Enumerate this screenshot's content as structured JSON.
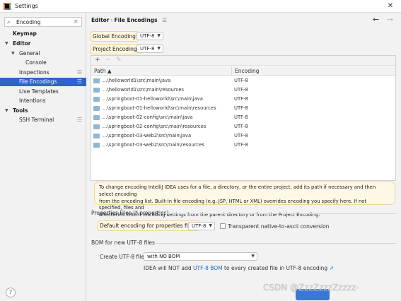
{
  "window": {
    "title": "Settings"
  },
  "sidebar": {
    "search_value": "Encoding",
    "items": [
      {
        "label": "Keymap"
      },
      {
        "label": "Editor"
      },
      {
        "label": "General"
      },
      {
        "label": "Console"
      },
      {
        "label": "Inspections"
      },
      {
        "label": "File Encodings"
      },
      {
        "label": "Live Templates"
      },
      {
        "label": "Intentions"
      },
      {
        "label": "Tools"
      },
      {
        "label": "SSH Terminal"
      }
    ]
  },
  "breadcrumb": {
    "parent": "Editor",
    "separator": "›",
    "current": "File Encodings"
  },
  "global": {
    "label": "Global Encoding:",
    "value": "UTF-8"
  },
  "project": {
    "label": "Project Encoding:",
    "value": "UTF-8"
  },
  "table": {
    "toolbar": {
      "add": "+",
      "remove": "−",
      "edit": "✎"
    },
    "columns": {
      "path": "Path ▲",
      "encoding": "Encoding"
    },
    "rows": [
      {
        "path": "...\\helloworld1\\src\\main\\java",
        "encoding": "UTF-8"
      },
      {
        "path": "...\\helloworld1\\src\\main\\resources",
        "encoding": "UTF-8"
      },
      {
        "path": "...\\springboot-01-helloworld\\src\\main\\java",
        "encoding": "UTF-8"
      },
      {
        "path": "...\\springboot-01-helloworld\\src\\main\\resources",
        "encoding": "UTF-8"
      },
      {
        "path": "...\\springboot-02-config\\src\\main\\java",
        "encoding": "UTF-8"
      },
      {
        "path": "...\\springboot-02-config\\src\\main\\resources",
        "encoding": "UTF-8"
      },
      {
        "path": "...\\springboot-03-web2\\src\\main\\java",
        "encoding": "UTF-8"
      },
      {
        "path": "...\\springboot-03-web2\\src\\main\\resources",
        "encoding": "UTF-8"
      }
    ]
  },
  "info": {
    "line1": "To change encoding IntelliJ IDEA uses for a file, a directory, or the entire project, add its path if necessary and then select encoding",
    "line2": "from the encoding list. Built-in file encoding (e.g. JSP, HTML or XML) overrides encoding you specify here. If not specified, files and",
    "line3": "directories inherit encoding settings from the parent directory or from the Project Encoding."
  },
  "properties": {
    "section_title": "Properties Files (*.properties)",
    "default_label": "Default encoding for properties files:",
    "default_value": "UTF-8",
    "transparent_label": "Transparent native-to-ascii conversion"
  },
  "bom": {
    "section_title": "BOM for new UTF-8 files",
    "create_label": "Create UTF-8 files:",
    "create_value": "with NO BOM",
    "note_prefix": "IDEA will NOT add ",
    "note_link": "UTF-8 BOM",
    "note_suffix": " to every created file in UTF-8 encoding",
    "note_arrow": "↗"
  },
  "footer": {
    "help": "?",
    "watermark": "CSDN @ZzzZzzzZzzzz-"
  },
  "colors": {
    "selection": "#2f65ca",
    "highlight_border": "#f0d39a",
    "highlight_bg": "#fff8e6",
    "link": "#2470b3",
    "folder": "#8fb6d6"
  }
}
